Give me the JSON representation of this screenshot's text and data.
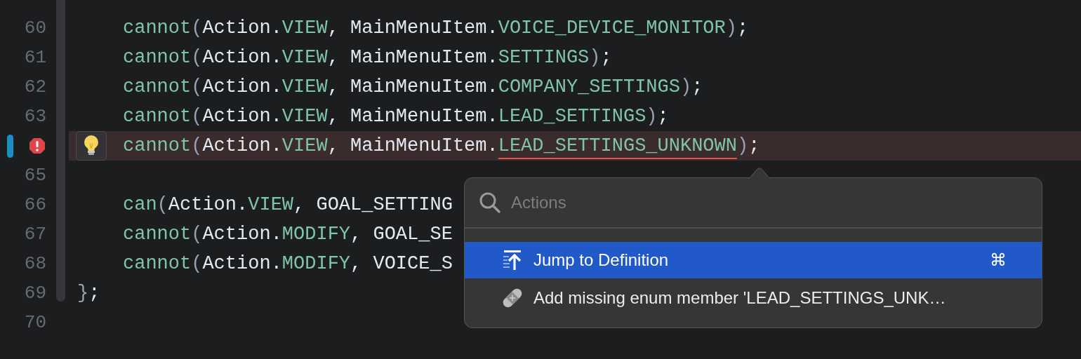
{
  "editor": {
    "block_lines": [
      {
        "number": "60",
        "error": false,
        "changed": false,
        "tokens": [
          {
            "kind": "fn",
            "text": "cannot"
          },
          {
            "kind": "punct",
            "text": "("
          },
          {
            "kind": "plain",
            "text": "Action."
          },
          {
            "kind": "member",
            "text": "VIEW"
          },
          {
            "kind": "plain",
            "text": ", MainMenuItem."
          },
          {
            "kind": "member",
            "text": "VOICE_DEVICE_MONITOR"
          },
          {
            "kind": "punct",
            "text": ")"
          },
          {
            "kind": "plain",
            "text": ";"
          }
        ]
      },
      {
        "number": "61",
        "error": false,
        "changed": false,
        "tokens": [
          {
            "kind": "fn",
            "text": "cannot"
          },
          {
            "kind": "punct",
            "text": "("
          },
          {
            "kind": "plain",
            "text": "Action."
          },
          {
            "kind": "member",
            "text": "VIEW"
          },
          {
            "kind": "plain",
            "text": ", MainMenuItem."
          },
          {
            "kind": "member",
            "text": "SETTINGS"
          },
          {
            "kind": "punct",
            "text": ")"
          },
          {
            "kind": "plain",
            "text": ";"
          }
        ]
      },
      {
        "number": "62",
        "error": false,
        "changed": false,
        "tokens": [
          {
            "kind": "fn",
            "text": "cannot"
          },
          {
            "kind": "punct",
            "text": "("
          },
          {
            "kind": "plain",
            "text": "Action."
          },
          {
            "kind": "member",
            "text": "VIEW"
          },
          {
            "kind": "plain",
            "text": ", MainMenuItem."
          },
          {
            "kind": "member",
            "text": "COMPANY_SETTINGS"
          },
          {
            "kind": "punct",
            "text": ")"
          },
          {
            "kind": "plain",
            "text": ";"
          }
        ]
      },
      {
        "number": "63",
        "error": false,
        "changed": false,
        "tokens": [
          {
            "kind": "fn",
            "text": "cannot"
          },
          {
            "kind": "punct",
            "text": "("
          },
          {
            "kind": "plain",
            "text": "Action."
          },
          {
            "kind": "member",
            "text": "VIEW"
          },
          {
            "kind": "plain",
            "text": ", MainMenuItem."
          },
          {
            "kind": "member",
            "text": "LEAD_SETTINGS"
          },
          {
            "kind": "punct",
            "text": ")"
          },
          {
            "kind": "plain",
            "text": ";"
          }
        ]
      },
      {
        "error": true,
        "changed": true,
        "tokens": [
          {
            "kind": "fn",
            "text": "cannot"
          },
          {
            "kind": "punct",
            "text": "("
          },
          {
            "kind": "plain",
            "text": "Action."
          },
          {
            "kind": "member",
            "text": "VIEW"
          },
          {
            "kind": "plain",
            "text": ", MainMenuItem."
          },
          {
            "kind": "error_member",
            "text": "LEAD_SETTINGS_UNKNOWN"
          },
          {
            "kind": "punct",
            "text": ")"
          },
          {
            "kind": "plain",
            "text": ";"
          }
        ]
      },
      {
        "number": "65",
        "error": false,
        "changed": false
      },
      {
        "number": "66",
        "error": false,
        "changed": false,
        "tokens": [
          {
            "kind": "fn",
            "text": "can"
          },
          {
            "kind": "punct",
            "text": "("
          },
          {
            "kind": "plain",
            "text": "Action."
          },
          {
            "kind": "member",
            "text": "VIEW"
          },
          {
            "kind": "plain",
            "text": ", GOAL_SETTING"
          }
        ]
      },
      {
        "number": "67",
        "error": false,
        "changed": false,
        "tokens": [
          {
            "kind": "fn",
            "text": "cannot"
          },
          {
            "kind": "punct",
            "text": "("
          },
          {
            "kind": "plain",
            "text": "Action."
          },
          {
            "kind": "member",
            "text": "MODIFY"
          },
          {
            "kind": "plain",
            "text": ", GOAL_SE"
          }
        ]
      },
      {
        "number": "68",
        "error": false,
        "changed": false,
        "tokens": [
          {
            "kind": "fn",
            "text": "cannot"
          },
          {
            "kind": "punct",
            "text": "("
          },
          {
            "kind": "plain",
            "text": "Action."
          },
          {
            "kind": "member",
            "text": "MODIFY"
          },
          {
            "kind": "plain",
            "text": ", VOICE_S"
          }
        ]
      }
    ],
    "lines_after": [
      {
        "number": "69",
        "error": false,
        "changed": false,
        "tokens": [
          {
            "kind": "punct",
            "text": "}"
          },
          {
            "kind": "plain",
            "text": ";"
          }
        ]
      },
      {
        "number": "70",
        "error": false,
        "changed": false
      }
    ]
  },
  "actions_popup": {
    "search": {
      "placeholder": "Actions"
    },
    "items": [
      {
        "kind": "navigate",
        "label": "Jump to Definition",
        "shortcut": "⌘",
        "selected": true
      },
      {
        "kind": "quickfix",
        "label": "Add missing enum member 'LEAD_SETTINGS_UNK…",
        "selected": false
      }
    ]
  }
}
